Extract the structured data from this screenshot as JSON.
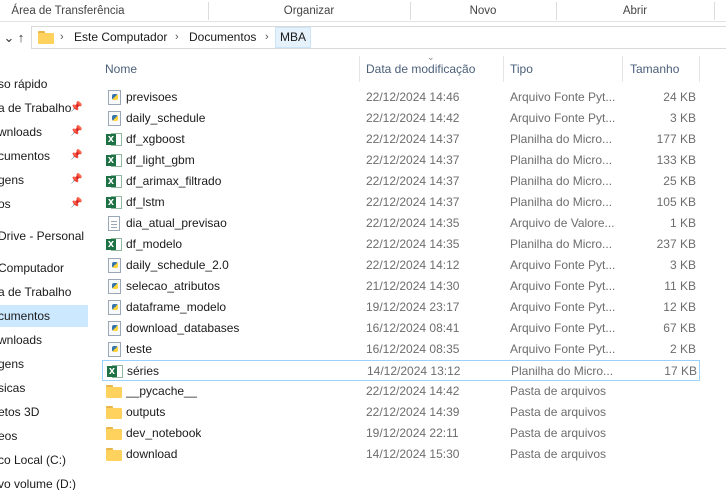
{
  "ribbon": {
    "groups": [
      "Área de Transferência",
      "Organizar",
      "Novo",
      "Abrir"
    ]
  },
  "address": {
    "crumbs": [
      "Este Computador",
      "Documentos",
      "MBA"
    ]
  },
  "navpane": {
    "items": [
      {
        "label": "so rápido",
        "pinned": false,
        "selected": false
      },
      {
        "label": "a de Trabalho",
        "pinned": true,
        "selected": false
      },
      {
        "label": "wnloads",
        "pinned": true,
        "selected": false
      },
      {
        "label": "cumentos",
        "pinned": true,
        "selected": false
      },
      {
        "label": "gens",
        "pinned": true,
        "selected": false
      },
      {
        "label": "os",
        "pinned": true,
        "selected": false
      },
      {
        "label": "Drive - Personal",
        "pinned": false,
        "selected": false
      },
      {
        "label": "Computador",
        "pinned": false,
        "selected": false
      },
      {
        "label": "a de Trabalho",
        "pinned": false,
        "selected": false
      },
      {
        "label": "cumentos",
        "pinned": false,
        "selected": true
      },
      {
        "label": "wnloads",
        "pinned": false,
        "selected": false
      },
      {
        "label": "gens",
        "pinned": false,
        "selected": false
      },
      {
        "label": "sicas",
        "pinned": false,
        "selected": false
      },
      {
        "label": "etos 3D",
        "pinned": false,
        "selected": false
      },
      {
        "label": "eos",
        "pinned": false,
        "selected": false
      },
      {
        "label": "co Local (C:)",
        "pinned": false,
        "selected": false
      },
      {
        "label": "vo volume (D:)",
        "pinned": false,
        "selected": false
      }
    ],
    "pin_glyph": "📌"
  },
  "columns": {
    "name": "Nome",
    "date": "Data de modificação",
    "type": "Tipo",
    "size": "Tamanho"
  },
  "files": [
    {
      "name": "previsoes",
      "date": "22/12/2024 14:46",
      "type": "Arquivo Fonte Pyt...",
      "size": "24 KB",
      "icon": "python-file-icon"
    },
    {
      "name": "daily_schedule",
      "date": "22/12/2024 14:42",
      "type": "Arquivo Fonte Pyt...",
      "size": "3 KB",
      "icon": "python-file-icon"
    },
    {
      "name": "df_xgboost",
      "date": "22/12/2024 14:37",
      "type": "Planilha do Micro...",
      "size": "177 KB",
      "icon": "excel-file-icon"
    },
    {
      "name": "df_light_gbm",
      "date": "22/12/2024 14:37",
      "type": "Planilha do Micro...",
      "size": "133 KB",
      "icon": "excel-file-icon"
    },
    {
      "name": "df_arimax_filtrado",
      "date": "22/12/2024 14:37",
      "type": "Planilha do Micro...",
      "size": "25 KB",
      "icon": "excel-file-icon"
    },
    {
      "name": "df_lstm",
      "date": "22/12/2024 14:37",
      "type": "Planilha do Micro...",
      "size": "105 KB",
      "icon": "excel-file-icon"
    },
    {
      "name": "dia_atual_previsao",
      "date": "22/12/2024 14:35",
      "type": "Arquivo de Valore...",
      "size": "1 KB",
      "icon": "text-file-icon"
    },
    {
      "name": "df_modelo",
      "date": "22/12/2024 14:35",
      "type": "Planilha do Micro...",
      "size": "237 KB",
      "icon": "excel-file-icon"
    },
    {
      "name": "daily_schedule_2.0",
      "date": "22/12/2024 14:12",
      "type": "Arquivo Fonte Pyt...",
      "size": "3 KB",
      "icon": "python-file-icon"
    },
    {
      "name": "selecao_atributos",
      "date": "21/12/2024 14:30",
      "type": "Arquivo Fonte Pyt...",
      "size": "11 KB",
      "icon": "python-file-icon"
    },
    {
      "name": "dataframe_modelo",
      "date": "19/12/2024 23:17",
      "type": "Arquivo Fonte Pyt...",
      "size": "12 KB",
      "icon": "python-file-icon"
    },
    {
      "name": "download_databases",
      "date": "16/12/2024 08:41",
      "type": "Arquivo Fonte Pyt...",
      "size": "67 KB",
      "icon": "python-file-icon"
    },
    {
      "name": "teste",
      "date": "16/12/2024 08:35",
      "type": "Arquivo Fonte Pyt...",
      "size": "2 KB",
      "icon": "python-file-icon"
    },
    {
      "name": "séries",
      "date": "14/12/2024 13:12",
      "type": "Planilha do Micro...",
      "size": "17 KB",
      "icon": "excel-file-icon",
      "focused": true
    },
    {
      "name": "__pycache__",
      "date": "22/12/2024 14:42",
      "type": "Pasta de arquivos",
      "size": "",
      "icon": "folder-icon"
    },
    {
      "name": "outputs",
      "date": "22/12/2024 14:39",
      "type": "Pasta de arquivos",
      "size": "",
      "icon": "folder-icon"
    },
    {
      "name": "dev_notebook",
      "date": "19/12/2024 22:11",
      "type": "Pasta de arquivos",
      "size": "",
      "icon": "folder-icon"
    },
    {
      "name": "download",
      "date": "14/12/2024 15:30",
      "type": "Pasta de arquivos",
      "size": "",
      "icon": "folder-icon"
    }
  ],
  "colors": {
    "selected_nav": "#cce8ff",
    "focus_outline": "#99d1ff",
    "excel_green": "#1e7145",
    "folder_yellow": "#ffd25e"
  }
}
